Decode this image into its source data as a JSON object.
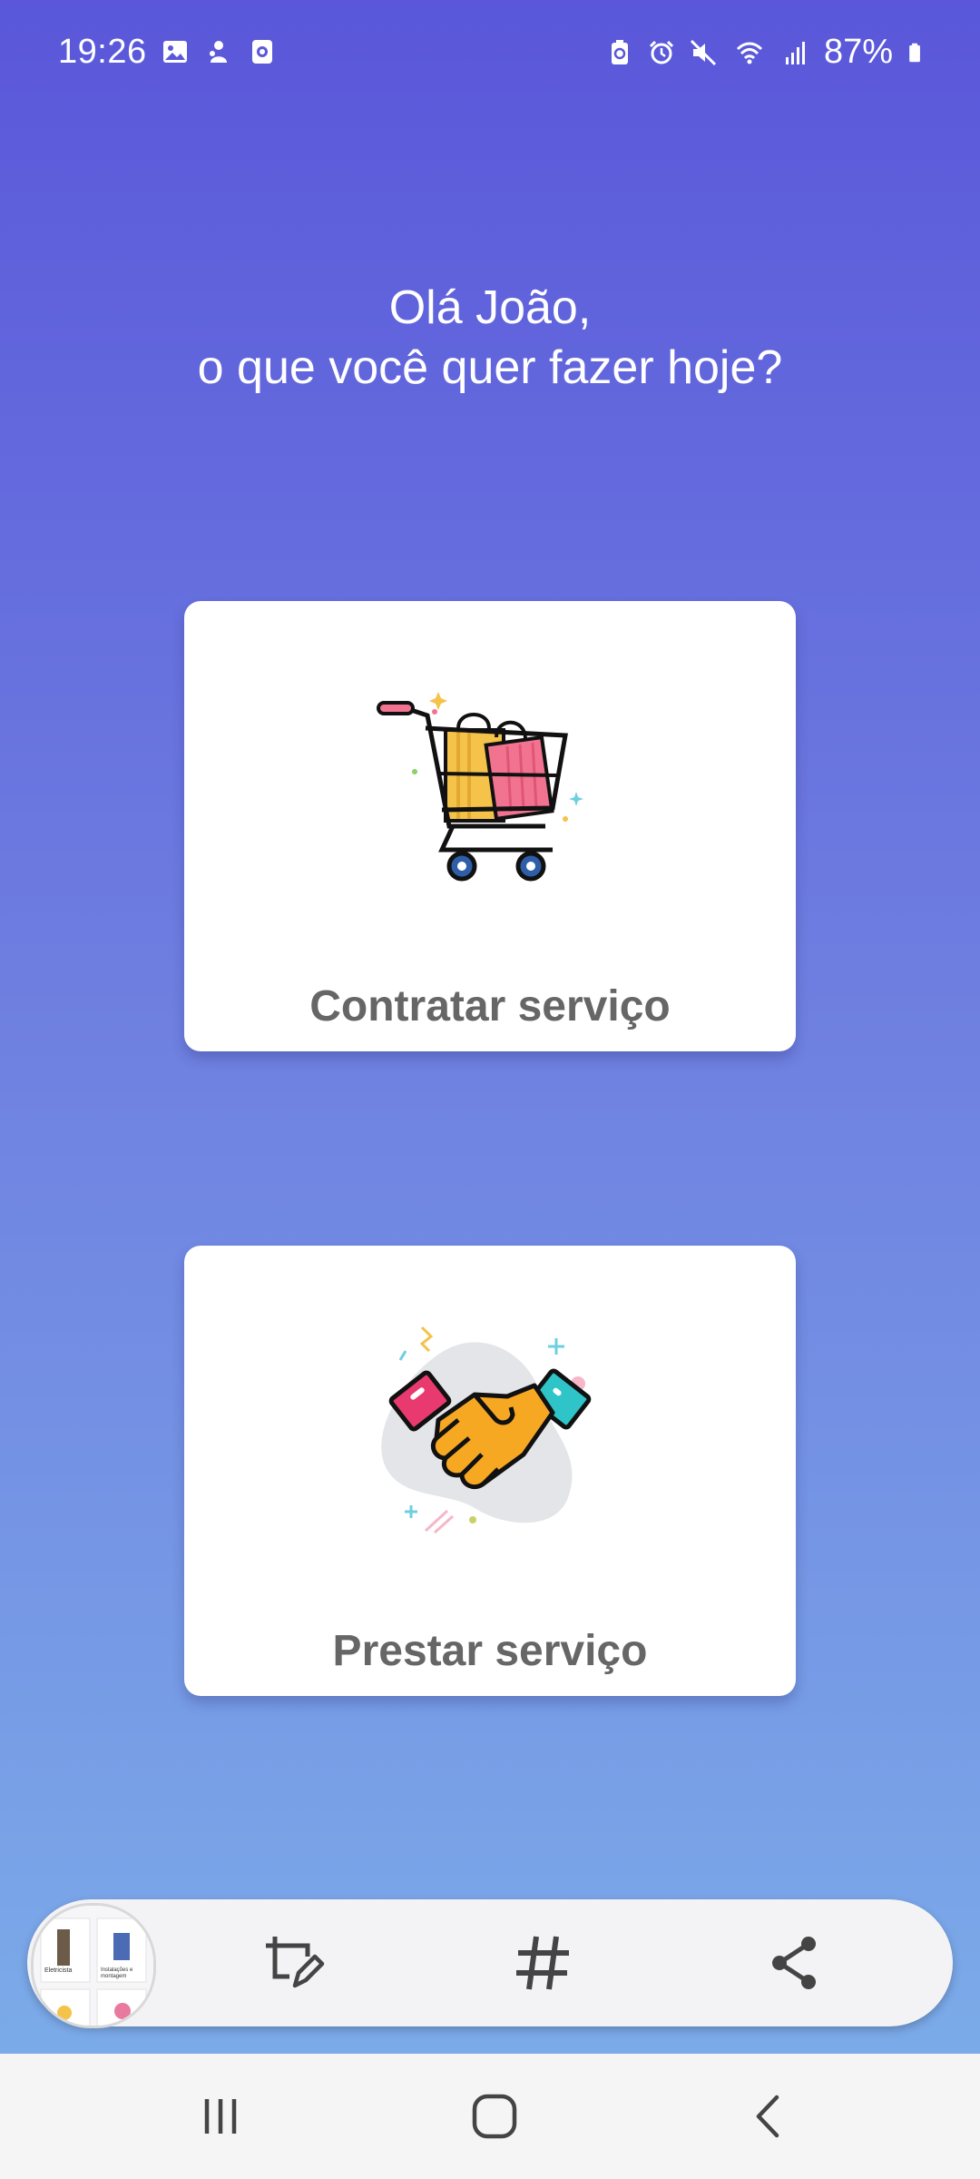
{
  "status_bar": {
    "time": "19:26",
    "battery": "87%",
    "icons": [
      "gallery-icon",
      "app-icon",
      "screen-record-icon",
      "battery-saver-icon",
      "alarm-icon",
      "mute-icon",
      "wifi-icon",
      "signal-icon",
      "battery-icon"
    ]
  },
  "greeting": {
    "line1": "Olá João,",
    "line2": "o que você quer fazer hoje?"
  },
  "cards": [
    {
      "label": "Contratar serviço",
      "icon": "shopping-cart-icon"
    },
    {
      "label": "Prestar serviço",
      "icon": "handshake-icon"
    }
  ],
  "toolbar": {
    "thumbnail_texts": [
      "Eletricista",
      "Instalações e montagem"
    ],
    "tools": [
      "crop-edit-icon",
      "hashtag-icon",
      "share-icon"
    ]
  },
  "navbar": {
    "buttons": [
      "recents-icon",
      "home-icon",
      "back-icon"
    ]
  },
  "colors": {
    "gradient_top": "#5a57da",
    "gradient_bottom": "#7db0ea",
    "card_label": "#666666"
  }
}
